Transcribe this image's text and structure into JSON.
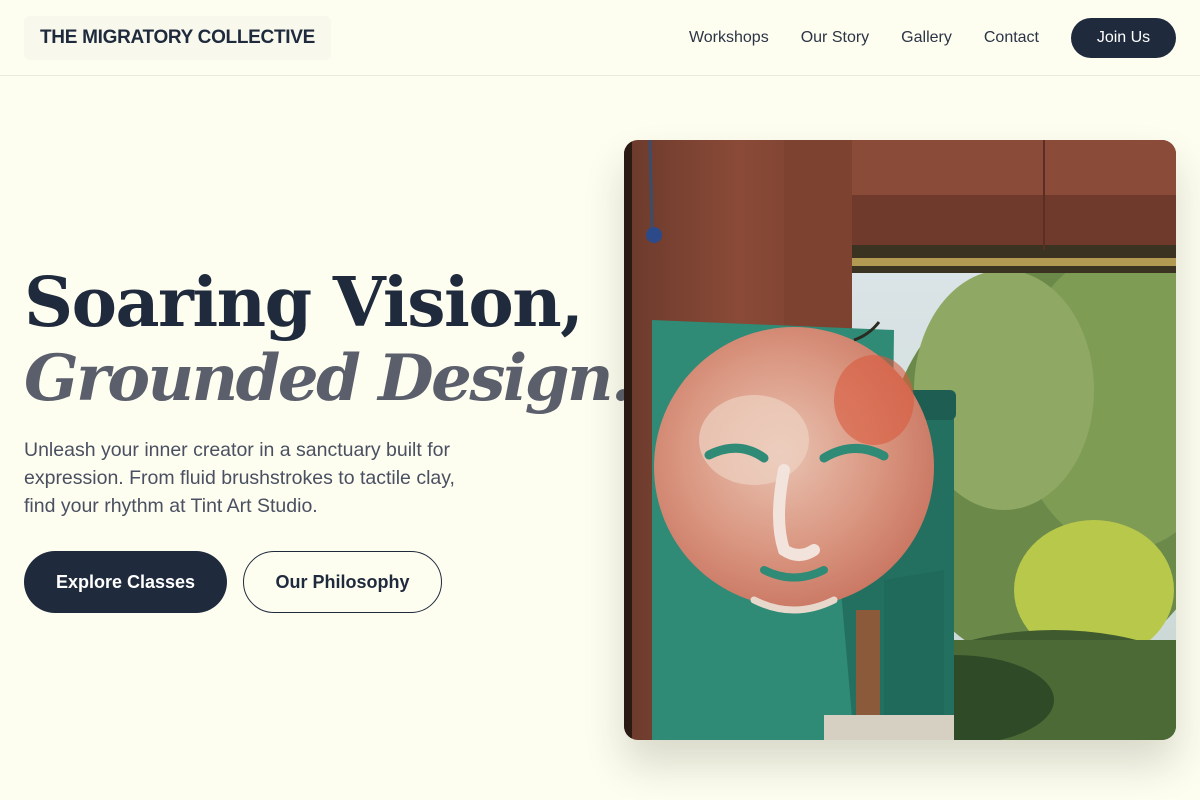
{
  "header": {
    "logo": "THE MIGRATORY COLLECTIVE",
    "nav": [
      {
        "label": "Workshops"
      },
      {
        "label": "Our Story"
      },
      {
        "label": "Gallery"
      },
      {
        "label": "Contact"
      }
    ],
    "cta": "Join Us"
  },
  "hero": {
    "headline_line1": "Soaring Vision,",
    "headline_line2": "Grounded Design.",
    "description": "Unleash your inner creator in a sanctuary built for expression. From fluid brushstrokes to tactile clay, find your rhythm at Tint Art Studio.",
    "primary_button": "Explore Classes",
    "secondary_button": "Our Philosophy"
  },
  "colors": {
    "background": "#fdfdf0",
    "primary": "#1f2a3d",
    "muted_heading": "#5b5f6b"
  }
}
